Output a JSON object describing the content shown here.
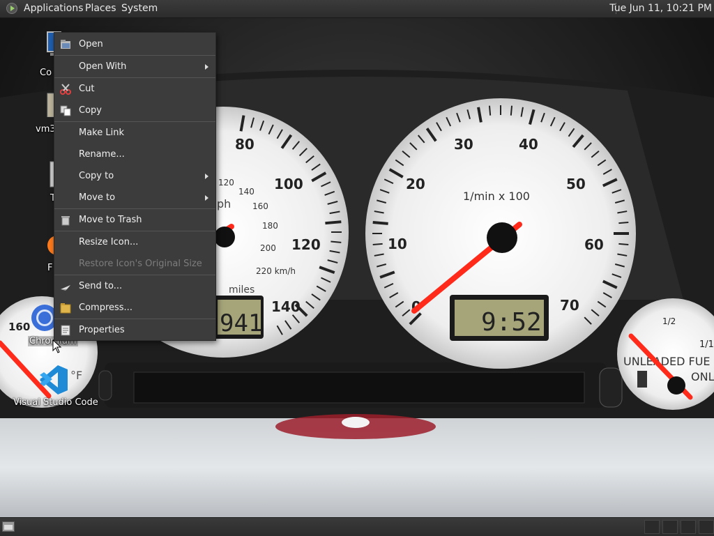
{
  "top_panel": {
    "menus": [
      "Applications",
      "Places",
      "System"
    ],
    "clock": "Tue Jun 11, 10:21 PM"
  },
  "wallpaper": {
    "speedo_numbers": [
      "80",
      "100",
      "120",
      "140"
    ],
    "speedo_kmh_numbers": [
      "120",
      "140",
      "160",
      "180",
      "200",
      "220 km/h"
    ],
    "speedo_unit_partial": "ph",
    "speedo_miles": "miles",
    "odometer": "941",
    "tacho_numbers": [
      "0",
      "10",
      "20",
      "30",
      "40",
      "50",
      "60",
      "70"
    ],
    "tacho_unit": "1/min x 100",
    "tacho_clock": "9:52",
    "left_gauge_number": "160",
    "left_gauge_unit": "°F",
    "fuel_half": "1/2",
    "fuel_full_partial": "1/1",
    "fuel_text_line1": "UNLEADED FUE",
    "fuel_text_line2": "ONL"
  },
  "desktop_icons": [
    {
      "label": "Co",
      "icon": "computer-icon"
    },
    {
      "label": "vm3",
      "icon": "home-folder-icon"
    },
    {
      "label": "T",
      "icon": "trash-icon"
    },
    {
      "label": "F",
      "icon": "firefox-icon"
    },
    {
      "label": "Chromium",
      "icon": "chromium-icon"
    },
    {
      "label": "Visual Studio Code",
      "icon": "vscode-icon"
    }
  ],
  "context_menu": {
    "items": [
      {
        "label": "Open",
        "icon": "open-icon",
        "submenu": false,
        "enabled": true
      },
      {
        "label": "Open With",
        "icon": "",
        "submenu": true,
        "enabled": true
      },
      {
        "label": "Cut",
        "icon": "scissors-icon",
        "submenu": false,
        "enabled": true
      },
      {
        "label": "Copy",
        "icon": "copy-icon",
        "submenu": false,
        "enabled": true
      },
      {
        "label": "Make Link",
        "icon": "",
        "submenu": false,
        "enabled": true
      },
      {
        "label": "Rename...",
        "icon": "",
        "submenu": false,
        "enabled": true
      },
      {
        "label": "Copy to",
        "icon": "",
        "submenu": true,
        "enabled": true
      },
      {
        "label": "Move to",
        "icon": "",
        "submenu": true,
        "enabled": true
      },
      {
        "label": "Move to Trash",
        "icon": "trash-icon",
        "submenu": false,
        "enabled": true
      },
      {
        "label": "Resize Icon...",
        "icon": "",
        "submenu": false,
        "enabled": true
      },
      {
        "label": "Restore Icon's Original Size",
        "icon": "",
        "submenu": false,
        "enabled": false
      },
      {
        "label": "Send to...",
        "icon": "send-icon",
        "submenu": false,
        "enabled": true
      },
      {
        "label": "Compress...",
        "icon": "archive-icon",
        "submenu": false,
        "enabled": true
      },
      {
        "label": "Properties",
        "icon": "properties-icon",
        "submenu": false,
        "enabled": true
      }
    ]
  },
  "colors": {
    "panel": "#2f2f2f",
    "menu_bg": "#3c3c3c",
    "menu_text": "#f0f0f0",
    "disabled_text": "#7d7d7d",
    "gauge_face": "#f2f2f2",
    "needle": "#ff2a1a",
    "lcd": "#a6a57a"
  }
}
